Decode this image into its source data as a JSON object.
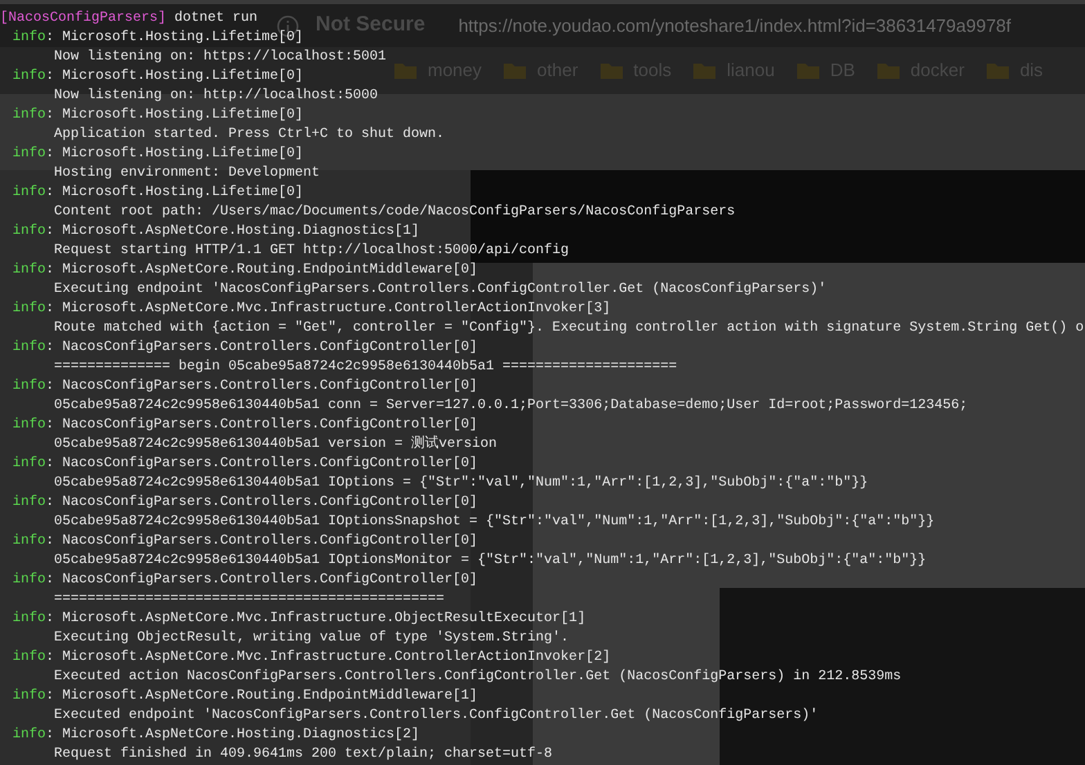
{
  "browser": {
    "security": "Not Secure",
    "url": "https://note.youdao.com/ynoteshare1/index.html?id=38631479a9978f",
    "bookmarks": [
      "money",
      "other",
      "tools",
      "lianou",
      "DB",
      "docker",
      "dis"
    ]
  },
  "prompt": {
    "directory": "[NacosConfigParsers]",
    "command": "dotnet run"
  },
  "entries": [
    {
      "level": "info",
      "source": ": Microsoft.Hosting.Lifetime[0]",
      "message": "Now listening on: https://localhost:5001"
    },
    {
      "level": "info",
      "source": ": Microsoft.Hosting.Lifetime[0]",
      "message": "Now listening on: http://localhost:5000"
    },
    {
      "level": "info",
      "source": ": Microsoft.Hosting.Lifetime[0]",
      "message": "Application started. Press Ctrl+C to shut down."
    },
    {
      "level": "info",
      "source": ": Microsoft.Hosting.Lifetime[0]",
      "message": "Hosting environment: Development"
    },
    {
      "level": "info",
      "source": ": Microsoft.Hosting.Lifetime[0]",
      "message": "Content root path: /Users/mac/Documents/code/NacosConfigParsers/NacosConfigParsers"
    },
    {
      "level": "info",
      "source": ": Microsoft.AspNetCore.Hosting.Diagnostics[1]",
      "message": "Request starting HTTP/1.1 GET http://localhost:5000/api/config"
    },
    {
      "level": "info",
      "source": ": Microsoft.AspNetCore.Routing.EndpointMiddleware[0]",
      "message": "Executing endpoint 'NacosConfigParsers.Controllers.ConfigController.Get (NacosConfigParsers)'"
    },
    {
      "level": "info",
      "source": ": Microsoft.AspNetCore.Mvc.Infrastructure.ControllerActionInvoker[3]",
      "message": "Route matched with {action = \"Get\", controller = \"Config\"}. Executing controller action with signature System.String Get() o"
    },
    {
      "level": "info",
      "source": ": NacosConfigParsers.Controllers.ConfigController[0]",
      "message": "============== begin 05cabe95a8724c2c9958e6130440b5a1 ====================="
    },
    {
      "level": "info",
      "source": ": NacosConfigParsers.Controllers.ConfigController[0]",
      "message": "05cabe95a8724c2c9958e6130440b5a1 conn = Server=127.0.0.1;Port=3306;Database=demo;User Id=root;Password=123456;"
    },
    {
      "level": "info",
      "source": ": NacosConfigParsers.Controllers.ConfigController[0]",
      "message": "05cabe95a8724c2c9958e6130440b5a1 version = 测试version"
    },
    {
      "level": "info",
      "source": ": NacosConfigParsers.Controllers.ConfigController[0]",
      "message": "05cabe95a8724c2c9958e6130440b5a1 IOptions = {\"Str\":\"val\",\"Num\":1,\"Arr\":[1,2,3],\"SubObj\":{\"a\":\"b\"}}"
    },
    {
      "level": "info",
      "source": ": NacosConfigParsers.Controllers.ConfigController[0]",
      "message": "05cabe95a8724c2c9958e6130440b5a1 IOptionsSnapshot = {\"Str\":\"val\",\"Num\":1,\"Arr\":[1,2,3],\"SubObj\":{\"a\":\"b\"}}"
    },
    {
      "level": "info",
      "source": ": NacosConfigParsers.Controllers.ConfigController[0]",
      "message": "05cabe95a8724c2c9958e6130440b5a1 IOptionsMonitor = {\"Str\":\"val\",\"Num\":1,\"Arr\":[1,2,3],\"SubObj\":{\"a\":\"b\"}}"
    },
    {
      "level": "info",
      "source": ": NacosConfigParsers.Controllers.ConfigController[0]",
      "message": "==============================================="
    },
    {
      "level": "info",
      "source": ": Microsoft.AspNetCore.Mvc.Infrastructure.ObjectResultExecutor[1]",
      "message": "Executing ObjectResult, writing value of type 'System.String'."
    },
    {
      "level": "info",
      "source": ": Microsoft.AspNetCore.Mvc.Infrastructure.ControllerActionInvoker[2]",
      "message": "Executed action NacosConfigParsers.Controllers.ConfigController.Get (NacosConfigParsers) in 212.8539ms"
    },
    {
      "level": "info",
      "source": ": Microsoft.AspNetCore.Routing.EndpointMiddleware[1]",
      "message": "Executed endpoint 'NacosConfigParsers.Controllers.ConfigController.Get (NacosConfigParsers)'"
    },
    {
      "level": "info",
      "source": ": Microsoft.AspNetCore.Hosting.Diagnostics[2]",
      "message": "Request finished in 409.9641ms 200 text/plain; charset=utf-8"
    }
  ]
}
